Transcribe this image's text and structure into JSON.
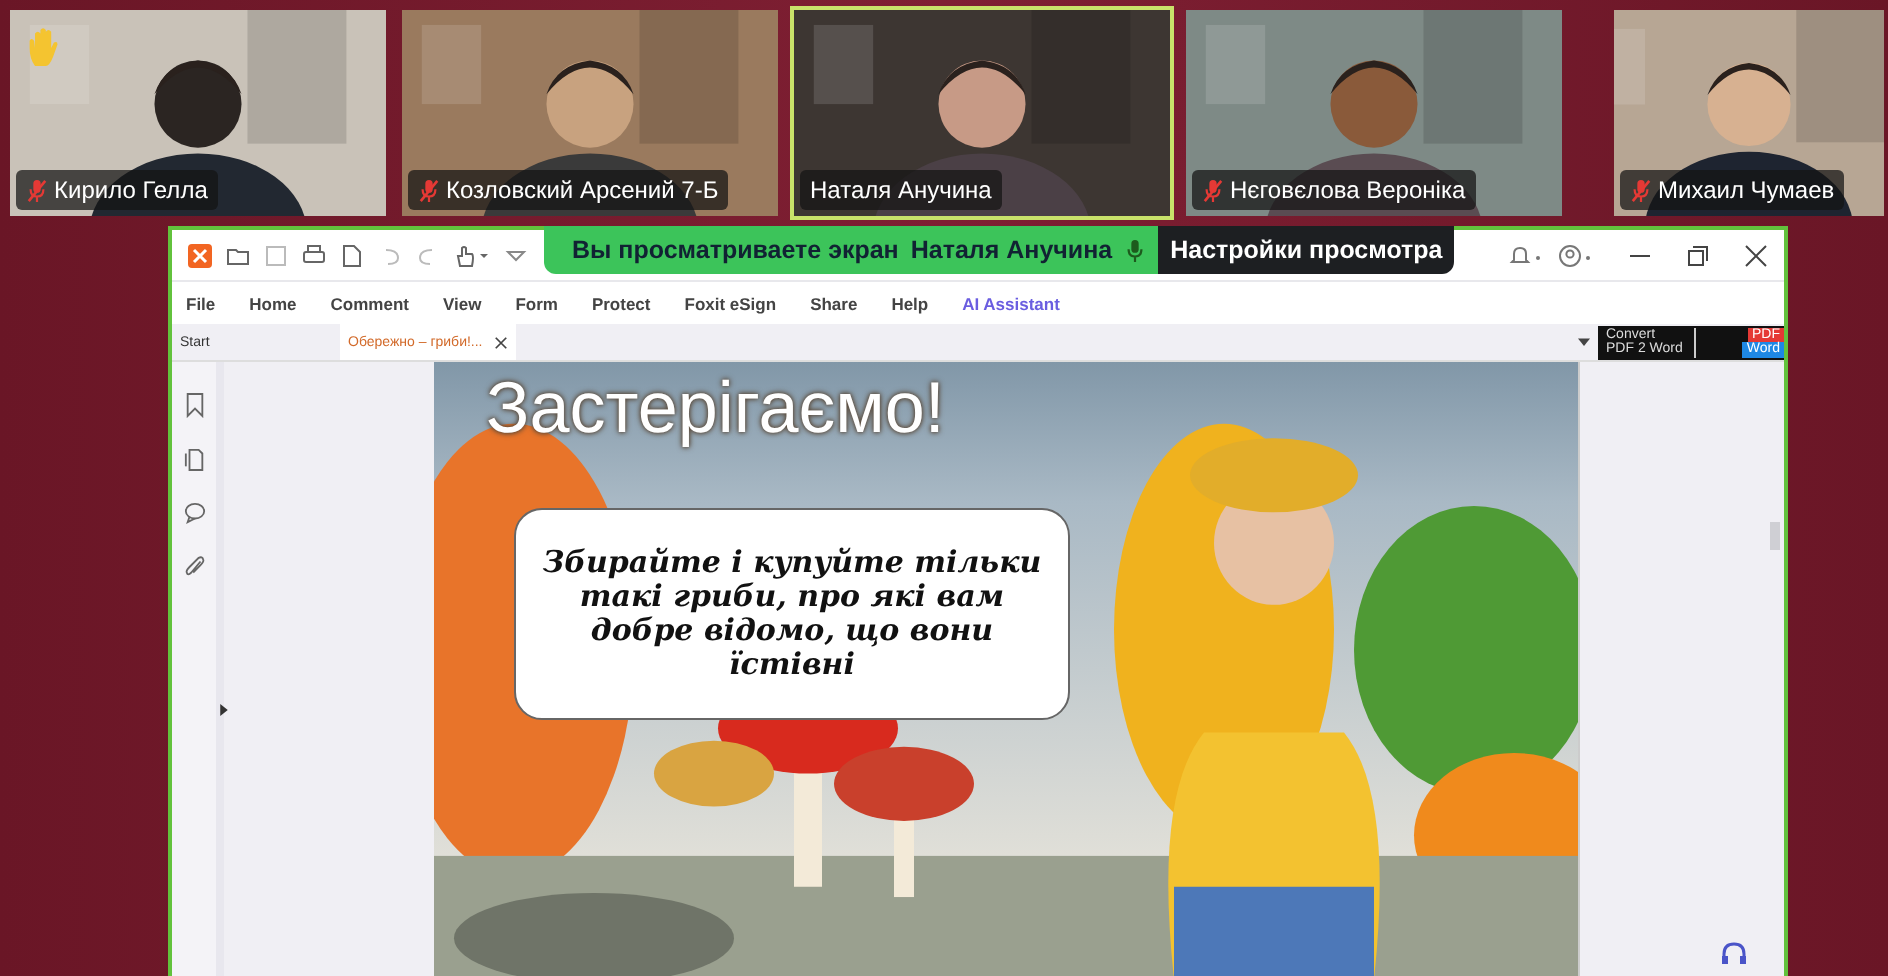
{
  "participants": [
    {
      "name": "Кирило Гелла",
      "muted": true,
      "hand_raised": true,
      "speaking": false
    },
    {
      "name": "Козловский Арсений 7-Б",
      "muted": true,
      "hand_raised": false,
      "speaking": false
    },
    {
      "name": "Наталя Анучина",
      "muted": false,
      "hand_raised": false,
      "speaking": true
    },
    {
      "name": "Нєговєлова Вероніка",
      "muted": true,
      "hand_raised": false,
      "speaking": false
    },
    {
      "name": "Михаил Чумаев",
      "muted": true,
      "hand_raised": false,
      "speaking": false
    }
  ],
  "share_banner": {
    "text": "Вы просматриваете экран",
    "presenter": "Наталя Анучина",
    "settings": "Настройки просмотра"
  },
  "menu": [
    {
      "label": "File",
      "accent": false
    },
    {
      "label": "Home",
      "accent": false
    },
    {
      "label": "Comment",
      "accent": false
    },
    {
      "label": "View",
      "accent": false
    },
    {
      "label": "Form",
      "accent": false
    },
    {
      "label": "Protect",
      "accent": false
    },
    {
      "label": "Foxit eSign",
      "accent": false
    },
    {
      "label": "Share",
      "accent": false
    },
    {
      "label": "Help",
      "accent": false
    },
    {
      "label": "AI Assistant",
      "accent": true
    }
  ],
  "tabs": [
    {
      "label": "Start",
      "selected": false
    },
    {
      "label": "Обережно – гриби!...",
      "selected": true
    }
  ],
  "convert_ad": {
    "line_1": "Convert",
    "line_2": "PDF 2 Word",
    "badge_1": "PDF",
    "badge_2": "Word"
  },
  "slide": {
    "heading": "Застерігаємо!",
    "callout": "Збирайте і купуйте тільки такі гриби, про які вам добре відомо, що вони їстівні"
  }
}
